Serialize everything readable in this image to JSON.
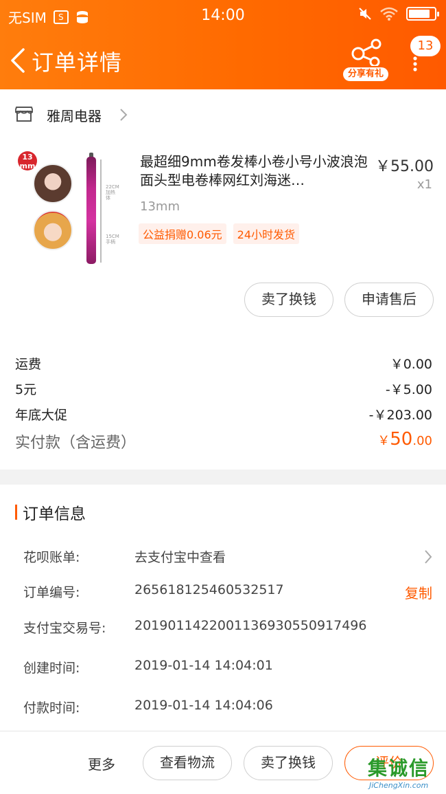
{
  "status_bar": {
    "carrier": "无SIM",
    "time": "14:00"
  },
  "header": {
    "title": "订单详情",
    "share_label": "分享有礼",
    "more_badge": "13"
  },
  "shop": {
    "name": "雅周电器"
  },
  "product": {
    "thumb_badge": "13 mm",
    "title": "最超细9mm卷发棒小卷小号小波浪泡面头型电卷棒网红刘海迷…",
    "price": "￥55.00",
    "quantity": "x1",
    "spec": "13mm",
    "tags": [
      "公益捐赠0.06元",
      "24小时发货"
    ]
  },
  "product_actions": {
    "sell_label": "卖了换钱",
    "aftersale_label": "申请售后"
  },
  "fees": [
    {
      "label": "运费",
      "amount": "￥0.00"
    },
    {
      "label": "5元",
      "amount": "-￥5.00"
    },
    {
      "label": "年底大促",
      "amount": "-￥203.00"
    }
  ],
  "total": {
    "label": "实付款（含运费）",
    "currency": "￥",
    "integer": "50",
    "decimal": ".00"
  },
  "order_info": {
    "title": "订单信息",
    "rows": [
      {
        "label": "花呗账单:",
        "value": "去支付宝中查看"
      },
      {
        "label": "订单编号:",
        "value": "265618125460532517",
        "action": "复制"
      },
      {
        "label": "支付宝交易号:",
        "value": "2019011422001136930550917496"
      },
      {
        "label": "创建时间:",
        "value": "2019-01-14 14:04:01"
      },
      {
        "label": "付款时间:",
        "value": "2019-01-14 14:04:06"
      }
    ]
  },
  "bottom_bar": {
    "more": "更多",
    "logistics": "查看物流",
    "sell": "卖了换钱",
    "review": "评价"
  },
  "watermark": {
    "text": "集诚信",
    "url": "JiChengXin.com"
  },
  "colors": {
    "accent": "#ff5a00",
    "header_start": "#ff7d0d",
    "header_end": "#ff5a00",
    "divider": "#f2f2f2"
  }
}
